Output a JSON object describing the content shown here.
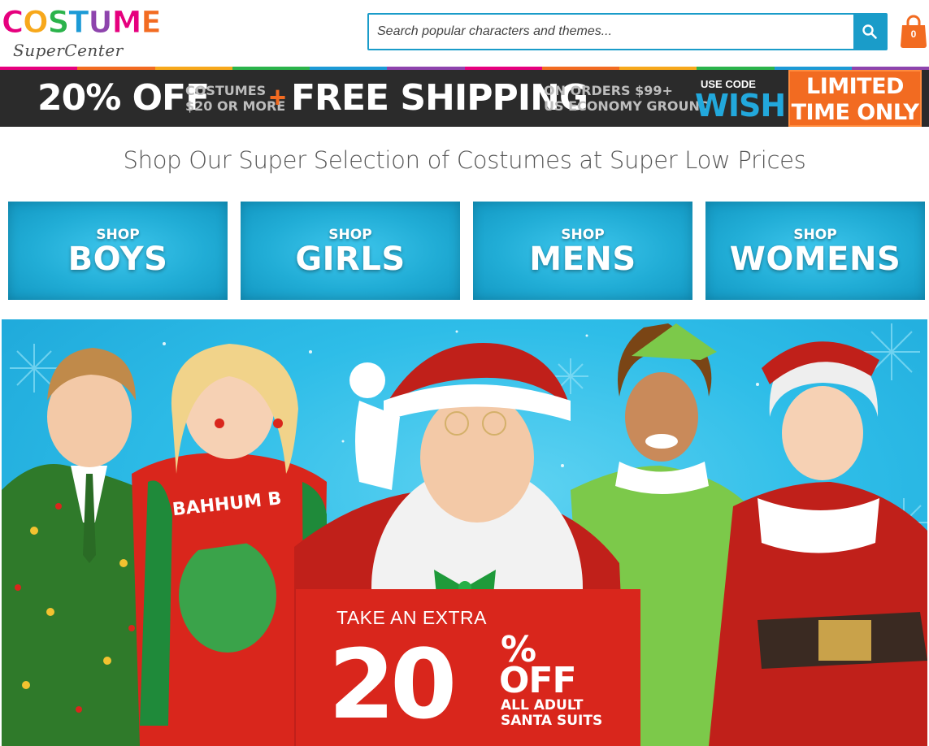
{
  "logo": {
    "top_letters": [
      {
        "char": "C",
        "color": "#e6007e"
      },
      {
        "char": "O",
        "color": "#f7a81b"
      },
      {
        "char": "S",
        "color": "#2bb34b"
      },
      {
        "char": "T",
        "color": "#1c9ad6"
      },
      {
        "char": "U",
        "color": "#8e44ad"
      },
      {
        "char": "M",
        "color": "#e6007e"
      },
      {
        "char": "E",
        "color": "#f26b21"
      }
    ],
    "bottom_text": "SuperCenter"
  },
  "search": {
    "placeholder": "Search popular characters and themes...",
    "value": ""
  },
  "cart": {
    "count": "0",
    "color": "#f26b21"
  },
  "rainbow_colors": [
    "#e6007e",
    "#f26b21",
    "#f7a81b",
    "#2bb34b",
    "#1c9ad6",
    "#8e44ad",
    "#e6007e",
    "#f26b21",
    "#f7a81b",
    "#2bb34b",
    "#1c9ad6",
    "#8e44ad"
  ],
  "promo": {
    "discount": "20% OFF",
    "discount_detail_1": "COSTUMES",
    "discount_detail_2": "$20 OR MORE",
    "plus": "+",
    "shipping": "FREE SHIPPING",
    "shipping_detail_1": "ON ORDERS $99+",
    "shipping_detail_2": "US ECONOMY GROUND",
    "use_code_label": "USE CODE",
    "code": "WISH",
    "limited_1": "LIMITED",
    "limited_2": "TIME ONLY"
  },
  "tagline": "Shop Our Super Selection of Costumes at Super Low Prices",
  "categories": [
    {
      "shop": "SHOP",
      "name": "BOYS"
    },
    {
      "shop": "SHOP",
      "name": "GIRLS"
    },
    {
      "shop": "SHOP",
      "name": "MENS"
    },
    {
      "shop": "SHOP",
      "name": "WOMENS"
    }
  ],
  "hero": {
    "offer_top": "TAKE AN EXTRA",
    "offer_value": "20",
    "offer_pct": "%",
    "offer_off": "OFF",
    "offer_sub_1": "ALL ADULT",
    "offer_sub_2": "SANTA SUITS",
    "sweater_text": "BAHHUM B"
  }
}
